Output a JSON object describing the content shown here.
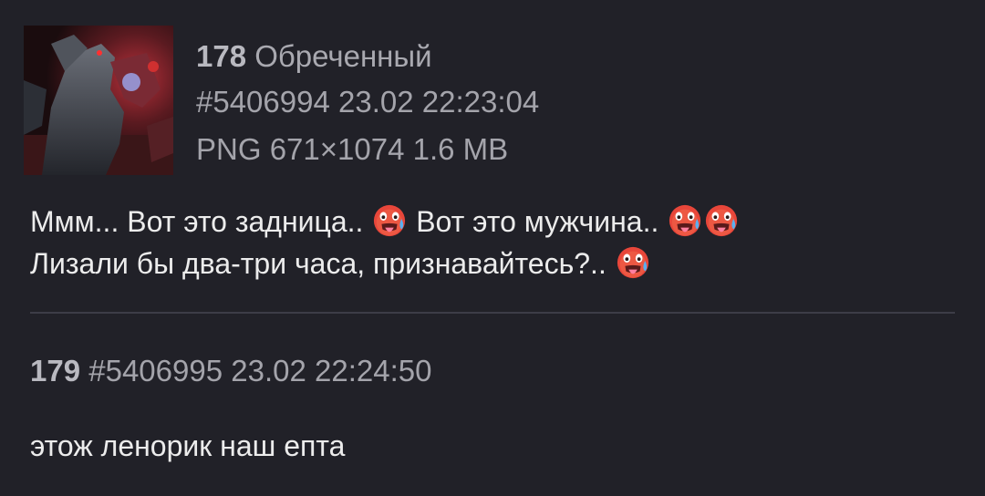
{
  "posts": [
    {
      "number": "178",
      "name": "Обреченный",
      "id": "#5406994",
      "date": "23.02",
      "time": "22:23:04",
      "file": {
        "type": "PNG",
        "dimensions": "671×1074",
        "size": "1.6 MB"
      },
      "text_line1_a": "Ммм... Вот это задница..",
      "text_line1_b": "Вот это мужчина..",
      "text_line2": "Лизали бы два-три часа, признавайтесь?..",
      "emoji": "hot-face-emoji"
    },
    {
      "number": "179",
      "id": "#5406995",
      "date": "23.02",
      "time": "22:24:50",
      "text": "этож ленорик наш епта"
    }
  ],
  "colors": {
    "background": "#212128",
    "text": "#ececec",
    "meta": "#a4a4ab",
    "divider": "#3d3d47"
  }
}
